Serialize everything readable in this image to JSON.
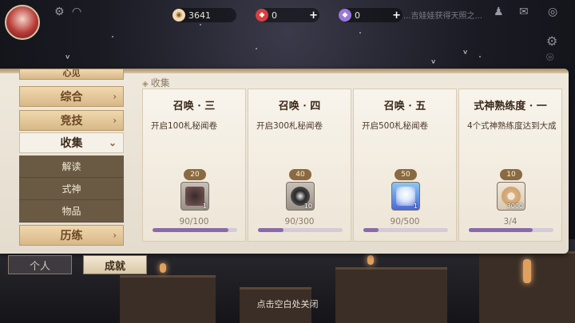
{
  "currencies": [
    {
      "name": "gold",
      "value": "3641",
      "color": "#f3d9b0"
    },
    {
      "name": "red-gem",
      "value": "0",
      "color": "#d84040"
    },
    {
      "name": "purple-gem",
      "value": "0",
      "color": "#9a78d8"
    }
  ],
  "marquee": "...吉娃娃获得天照之...",
  "section_title": "收集",
  "sidebar": {
    "top_partial": "心见",
    "items": [
      {
        "label": "综合"
      },
      {
        "label": "竞技"
      },
      {
        "label": "收集"
      },
      {
        "label": "历练"
      }
    ],
    "sub_items": [
      {
        "label": "解读"
      },
      {
        "label": "式神"
      },
      {
        "label": "物品"
      }
    ]
  },
  "cards": [
    {
      "title": "召唤 · 三",
      "desc": "开启100札秘闻卷",
      "reward_points": "20",
      "reward_qty": "1",
      "progress": "90/100",
      "fill": 0.9
    },
    {
      "title": "召唤 · 四",
      "desc": "开启300札秘闻卷",
      "reward_points": "40",
      "reward_qty": "10",
      "progress": "90/300",
      "fill": 0.3
    },
    {
      "title": "召唤 · 五",
      "desc": "开启500札秘闻卷",
      "reward_points": "50",
      "reward_qty": "1",
      "progress": "90/500",
      "fill": 0.18
    },
    {
      "title": "式神熟练度 · 一",
      "desc": "4个式神熟练度达到大成",
      "reward_points": "10",
      "reward_qty": "3000",
      "progress": "3/4",
      "fill": 0.75
    }
  ],
  "tabs": {
    "personal": "个人",
    "achievement": "成就"
  },
  "close_hint": "点击空白处关闭",
  "colors": {
    "accent": "#8a6aa8",
    "sidebar_button": "#d8b888",
    "panel": "#efe9dd"
  }
}
